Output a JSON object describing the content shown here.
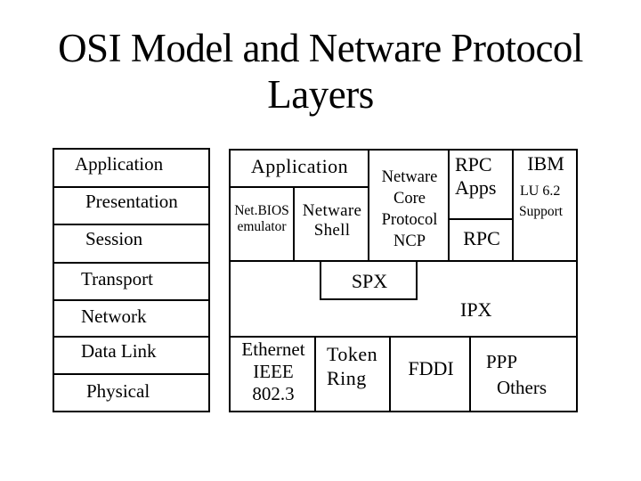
{
  "title": {
    "line1": "OSI Model and Netware Protocol",
    "line2": "Layers"
  },
  "osi_layers": [
    {
      "name": "Application"
    },
    {
      "name": "Presentation"
    },
    {
      "name": "Session"
    },
    {
      "name": "Transport"
    },
    {
      "name": "Network"
    },
    {
      "name": "Data Link"
    },
    {
      "name": "Physical"
    }
  ],
  "netware": {
    "application": "Application",
    "netbios": {
      "line1": "Net.BIOS",
      "line2": "emulator"
    },
    "shell": {
      "line1": "Netware",
      "line2": "Shell"
    },
    "ncp": {
      "line1": "Netware",
      "line2": "Core",
      "line3": "Protocol",
      "line4": "NCP"
    },
    "rpc_apps": {
      "line1": "RPC",
      "line2": "Apps"
    },
    "rpc": "RPC",
    "ibm": {
      "line1": "IBM",
      "line2": "LU 6.2",
      "line3": "Support"
    },
    "spx": "SPX",
    "ipx": "IPX",
    "ethernet": {
      "line1": "Ethernet",
      "line2": "IEEE",
      "line3": "802.3"
    },
    "token_ring": {
      "line1": "Token",
      "line2": "Ring"
    },
    "fddi": "FDDI",
    "ppp": {
      "line1": "PPP",
      "line2": "Others"
    }
  }
}
